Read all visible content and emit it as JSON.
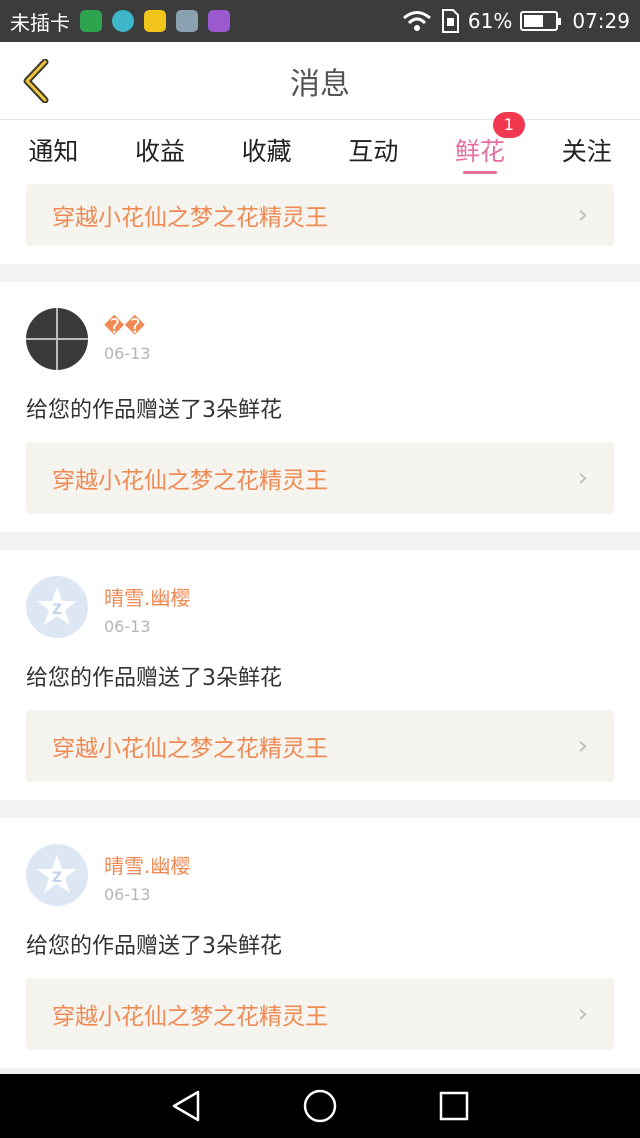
{
  "status_bar": {
    "carrier": "未插卡",
    "battery": "61%",
    "time": "07:29"
  },
  "header": {
    "title": "消息"
  },
  "tabs": [
    {
      "label": "通知"
    },
    {
      "label": "收益"
    },
    {
      "label": "收藏"
    },
    {
      "label": "互动"
    },
    {
      "label": "鲜花",
      "badge": "1",
      "active": true
    },
    {
      "label": "关注"
    }
  ],
  "top_card": {
    "work_title": "穿越小花仙之梦之花精灵王"
  },
  "messages": [
    {
      "user": "��",
      "date": "06-13",
      "text": "给您的作品赠送了3朵鲜花",
      "work_title": "穿越小花仙之梦之花精灵王",
      "avatar": "photo"
    },
    {
      "user": "晴雪.幽樱",
      "date": "06-13",
      "text": "给您的作品赠送了3朵鲜花",
      "work_title": "穿越小花仙之梦之花精灵王",
      "avatar": "qq-default-icon"
    },
    {
      "user": "晴雪.幽樱",
      "date": "06-13",
      "text": "给您的作品赠送了3朵鲜花",
      "work_title": "穿越小花仙之梦之花精灵王",
      "avatar": "qq-default-icon"
    }
  ],
  "colors": {
    "accent_pink": "#e76f9f",
    "orange_text": "#ef8a55",
    "badge_red": "#f1384f"
  }
}
